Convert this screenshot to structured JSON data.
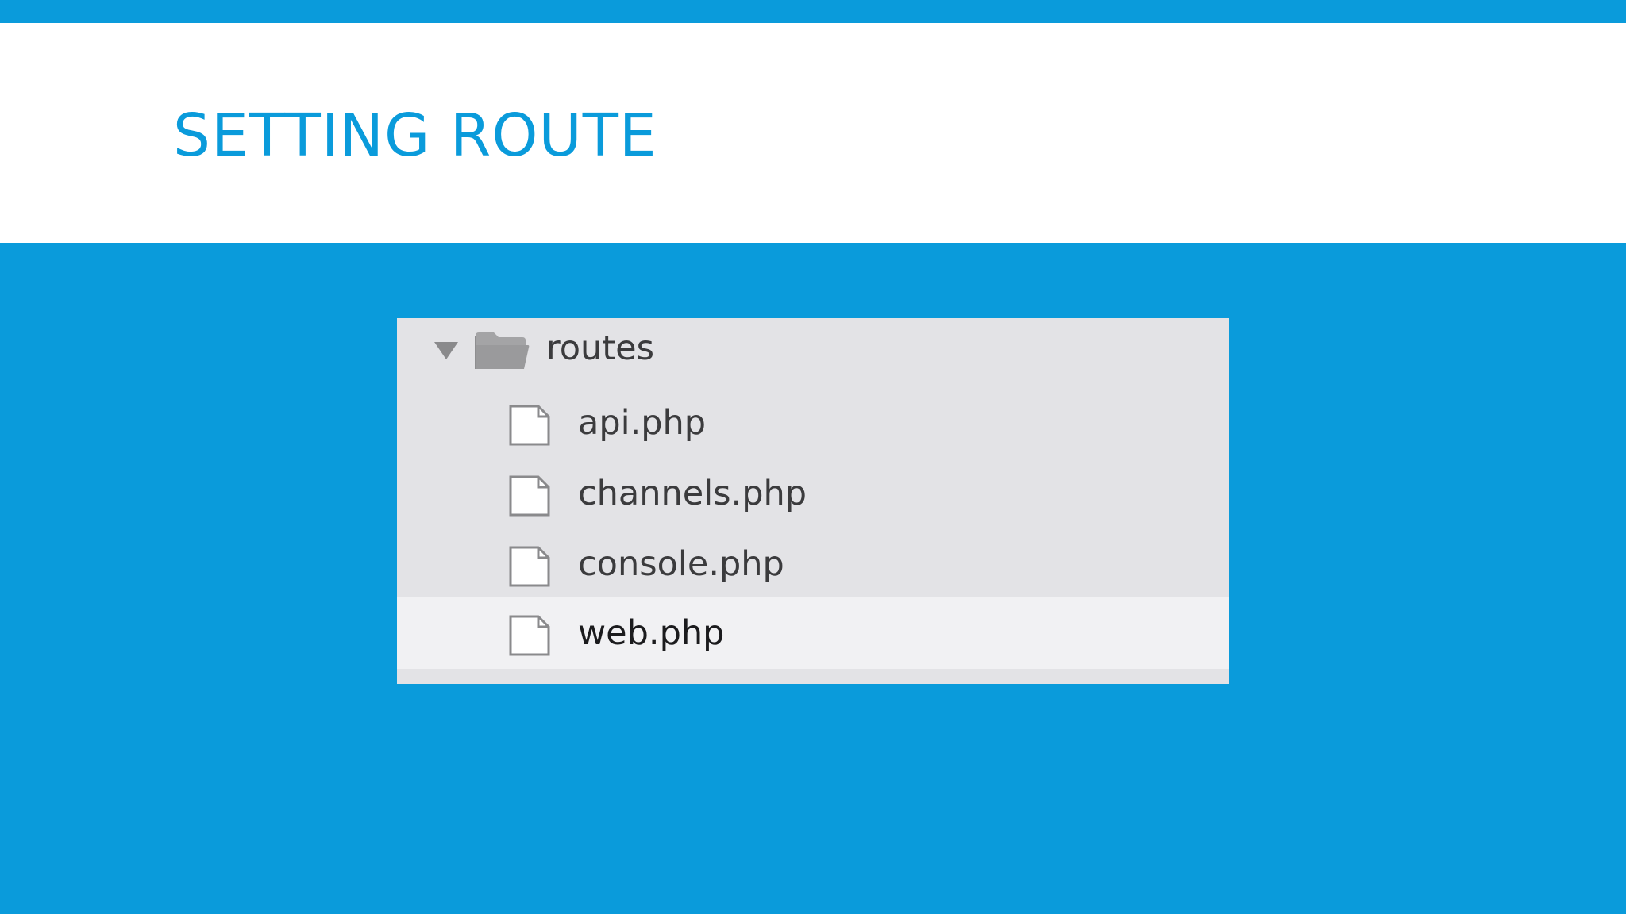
{
  "slide": {
    "title": "SETTING ROUTE",
    "colors": {
      "background": "#0a9bdb",
      "title_band": "#ffffff",
      "title_text": "#0a9bdb",
      "panel": "#e3e3e6",
      "selected_row": "#f1f1f3",
      "icon": "#9d9d9f"
    }
  },
  "explorer": {
    "folder": {
      "name": "routes",
      "expanded": true,
      "icon": "folder-icon"
    },
    "files": [
      {
        "name": "api.php",
        "icon": "file-icon",
        "selected": false
      },
      {
        "name": "channels.php",
        "icon": "file-icon",
        "selected": false
      },
      {
        "name": "console.php",
        "icon": "file-icon",
        "selected": false
      },
      {
        "name": "web.php",
        "icon": "file-icon",
        "selected": true
      }
    ]
  }
}
